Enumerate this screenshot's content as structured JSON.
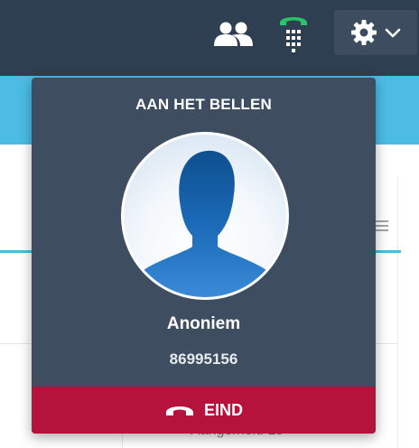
{
  "topbar": {
    "icons": {
      "contacts": "contacts-icon",
      "dialer": "phone-dialpad-icon",
      "settings": "gear-icon",
      "settings_caret": "chevron-down-icon"
    },
    "colors": {
      "background": "#2e3f51",
      "dialer_handset": "#27c46b"
    }
  },
  "call": {
    "title": "AAN HET BELLEN",
    "caller_name": "Anoniem",
    "caller_number": "86995156",
    "end_label": "EIND",
    "avatar_icon": "person-silhouette-icon",
    "hangup_icon": "phone-hangup-icon",
    "colors": {
      "panel": "#3e4e60",
      "end_button": "#b5123c"
    }
  },
  "background": {
    "status_text": "Aangemeld 15"
  }
}
